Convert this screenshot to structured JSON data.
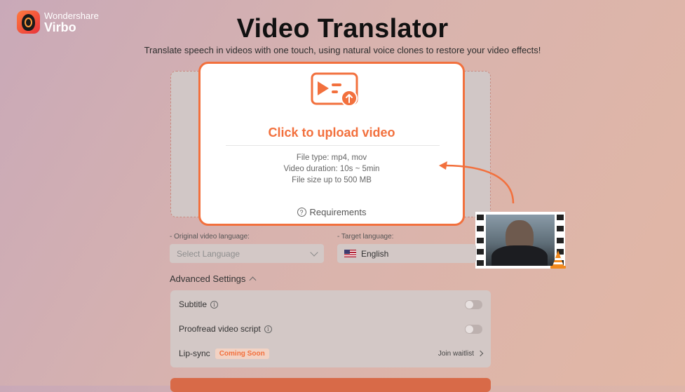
{
  "brand": {
    "top": "Wondershare",
    "name": "Virbo"
  },
  "page": {
    "title": "Video Translator",
    "subtitle": "Translate speech in videos with one touch, using natural voice clones to restore your video effects!"
  },
  "upload": {
    "title": "Click to upload video",
    "info": [
      "File type: mp4, mov",
      "Video duration: 10s ~ 5min",
      "File size up to 500 MB"
    ],
    "requirements": "Requirements",
    "accent_color": "#f2703d"
  },
  "languages": {
    "original_label": "- Original video language:",
    "original_placeholder": "Select Language",
    "target_label": "- Target language:",
    "target_value": "English",
    "target_flag": "us-flag-icon"
  },
  "advanced": {
    "title": "Advanced Settings",
    "subtitle_label": "Subtitle",
    "proofread_label": "Proofread video script",
    "lipsync_label": "Lip-sync",
    "lipsync_badge": "Coming Soon",
    "waitlist_label": "Join waitlist"
  }
}
